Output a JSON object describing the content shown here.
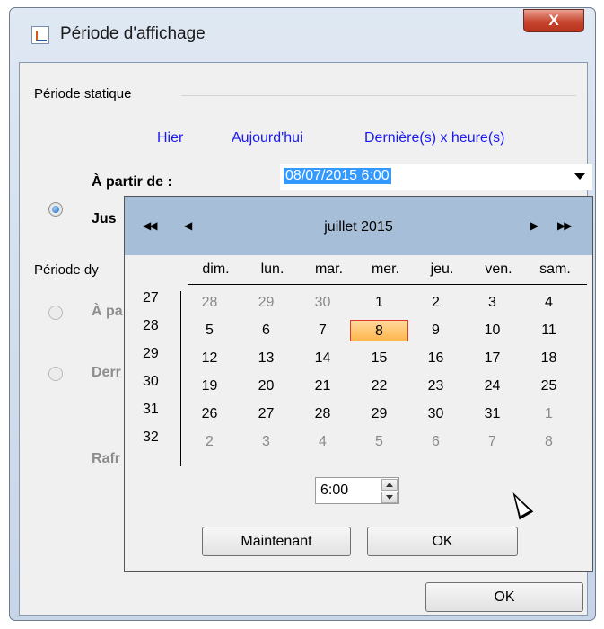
{
  "window": {
    "title": "Période d'affichage",
    "close_label": "X"
  },
  "static_group": {
    "label": "Période statique",
    "links": [
      "Hier",
      "Aujourd'hui",
      "Dernière(s) x heure(s)"
    ],
    "from_label": "À partir de :",
    "to_label_partial": "Jus",
    "from_value": "08/07/2015 6:00"
  },
  "dynamic_group": {
    "label_partial": "Période dy",
    "option1_partial": "À pa",
    "option2_partial": "Derr",
    "refresh_partial": "Rafr"
  },
  "calendar": {
    "month_label": "juillet  2015",
    "nav_prev_year": "◀◀",
    "nav_prev_month": "◀",
    "nav_next_month": "▶",
    "nav_next_year": "▶▶",
    "days_of_week": [
      "dim.",
      "lun.",
      "mar.",
      "mer.",
      "jeu.",
      "ven.",
      "sam."
    ],
    "weeks": [
      "27",
      "28",
      "29",
      "30",
      "31",
      "32"
    ],
    "rows": [
      [
        {
          "d": "28",
          "out": true
        },
        {
          "d": "29",
          "out": true
        },
        {
          "d": "30",
          "out": true
        },
        {
          "d": "1"
        },
        {
          "d": "2"
        },
        {
          "d": "3"
        },
        {
          "d": "4"
        }
      ],
      [
        {
          "d": "5"
        },
        {
          "d": "6"
        },
        {
          "d": "7"
        },
        {
          "d": "8",
          "selected": true
        },
        {
          "d": "9"
        },
        {
          "d": "10"
        },
        {
          "d": "11"
        }
      ],
      [
        {
          "d": "12"
        },
        {
          "d": "13"
        },
        {
          "d": "14"
        },
        {
          "d": "15"
        },
        {
          "d": "16"
        },
        {
          "d": "17"
        },
        {
          "d": "18"
        }
      ],
      [
        {
          "d": "19"
        },
        {
          "d": "20"
        },
        {
          "d": "21"
        },
        {
          "d": "22"
        },
        {
          "d": "23"
        },
        {
          "d": "24"
        },
        {
          "d": "25"
        }
      ],
      [
        {
          "d": "26"
        },
        {
          "d": "27"
        },
        {
          "d": "28"
        },
        {
          "d": "29"
        },
        {
          "d": "30"
        },
        {
          "d": "31"
        },
        {
          "d": "1",
          "out": true
        }
      ],
      [
        {
          "d": "2",
          "out": true
        },
        {
          "d": "3",
          "out": true
        },
        {
          "d": "4",
          "out": true
        },
        {
          "d": "5",
          "out": true
        },
        {
          "d": "6",
          "out": true
        },
        {
          "d": "7",
          "out": true
        },
        {
          "d": "8",
          "out": true
        }
      ]
    ],
    "time_value": "6:00",
    "now_button": "Maintenant",
    "ok_button": "OK"
  },
  "dialog_ok_button": "OK",
  "colors": {
    "header_bg": "#a6bed7",
    "selection_bg": "#3399ff",
    "selected_day_border": "#e03a2a",
    "link": "#1a1af0"
  }
}
